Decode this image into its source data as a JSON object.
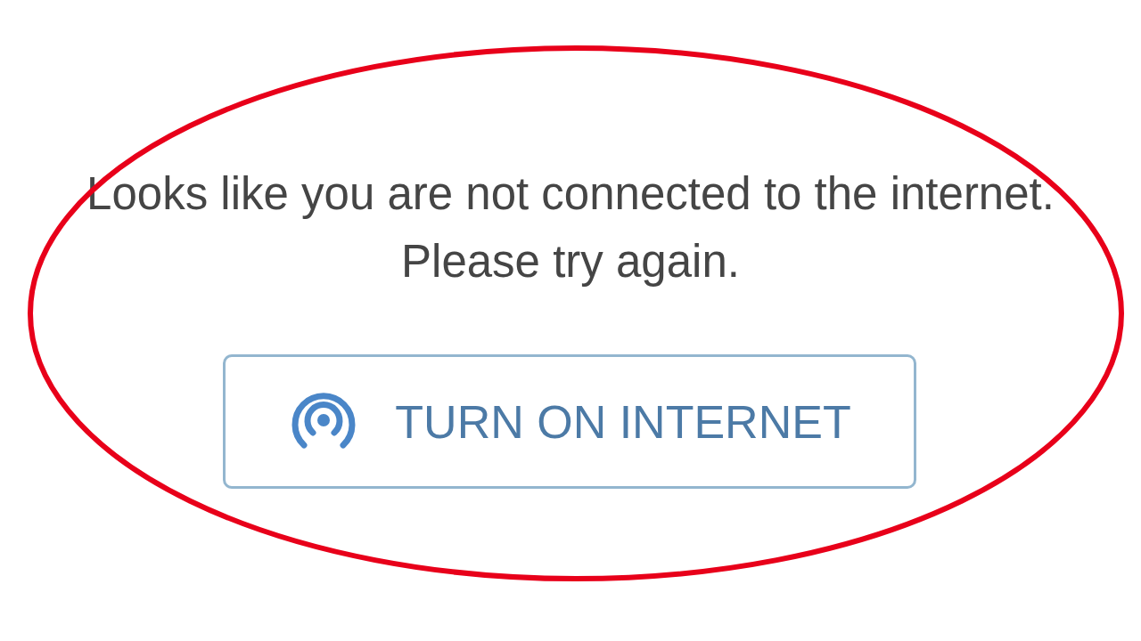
{
  "message": "Looks like you are not connected to the internet. Please try again.",
  "button": {
    "label": "TURN ON INTERNET"
  }
}
